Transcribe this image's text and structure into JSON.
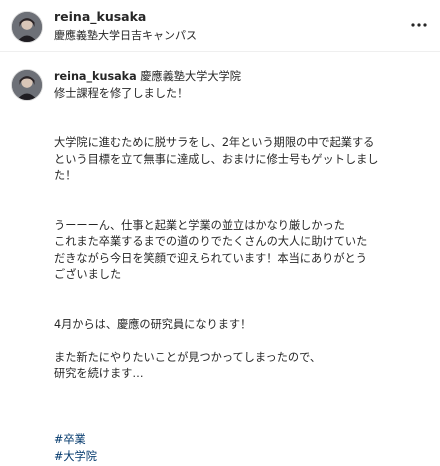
{
  "header": {
    "username": "reina_kusaka",
    "location": "慶應義塾大学日吉キャンパス",
    "more_icon": "more-horizontal-icon"
  },
  "caption": {
    "username": "reina_kusaka",
    "lines": [
      "慶應義塾大学大学院",
      "修士課程を修了しました！",
      "",
      "",
      "大学院に進むために脱サラをし、2年という期限の中で起業する",
      "という目標を立て無事に達成し、おまけに修士号もゲットしまし",
      "た！",
      "",
      "",
      "うーーーん、仕事と起業と学業の並立はかなり厳しかった",
      "これまた卒業するまでの道のりでたくさんの大人に助けていた",
      "だきながら今日を笑顔で迎えられています！本当にありがとう",
      "ございました",
      "",
      "",
      "4月からは、慶應の研究員になります！",
      "",
      "また新たにやりたいことが見つかってしまったので、",
      "研究を続けます…",
      "",
      "",
      ""
    ],
    "hashtags": [
      "#卒業",
      "#大学院"
    ]
  }
}
